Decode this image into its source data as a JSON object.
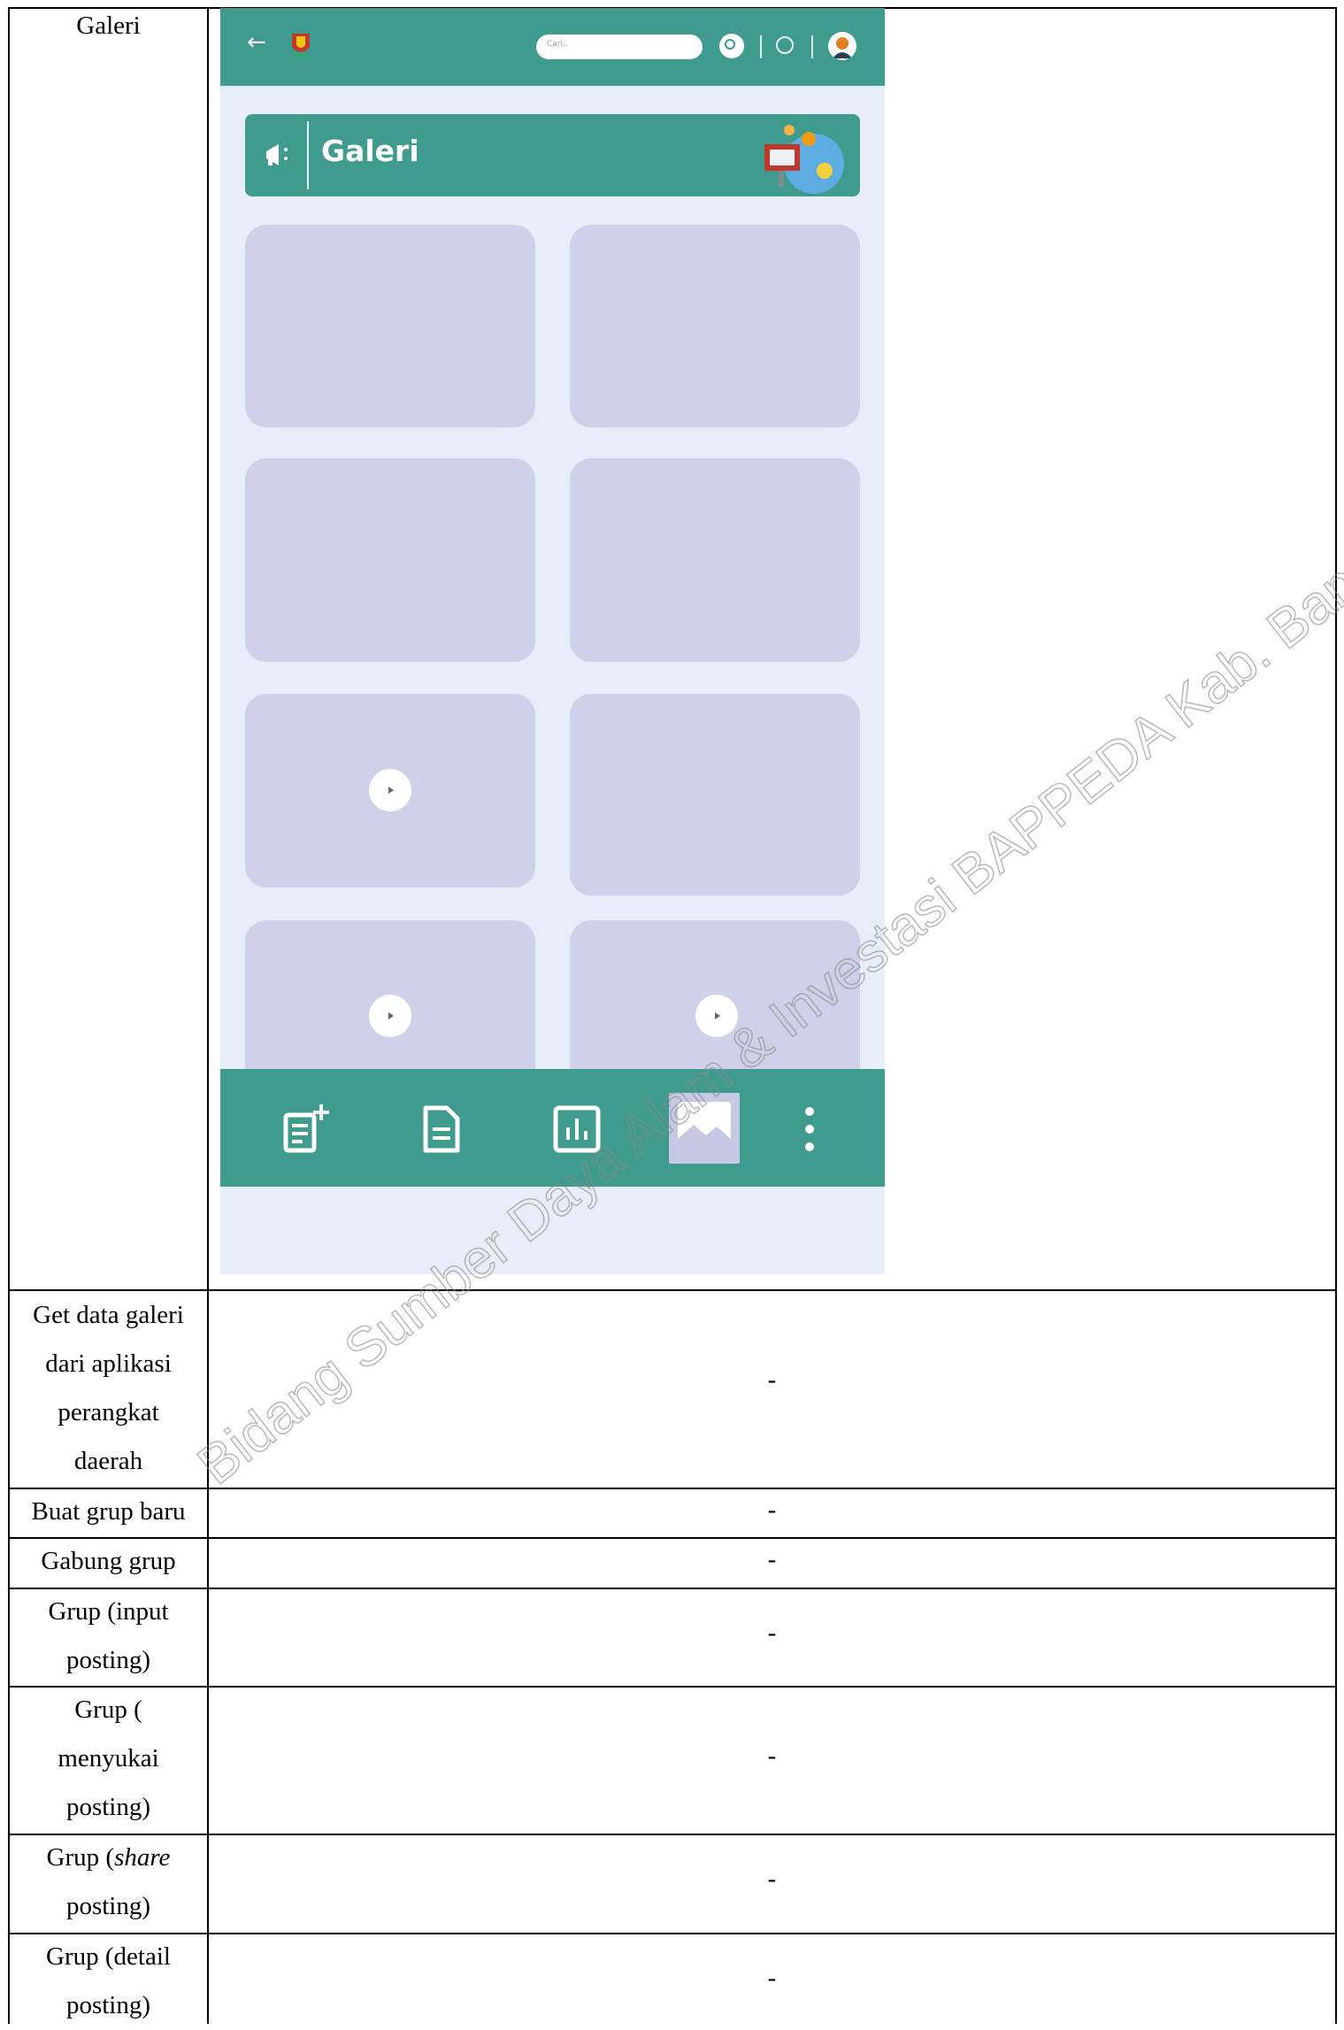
{
  "rows": [
    {
      "label_lines": [
        "Galeri"
      ],
      "value": ""
    },
    {
      "label_lines": [
        "Get data galeri",
        "dari aplikasi",
        "perangkat",
        "daerah"
      ],
      "value": "-"
    },
    {
      "label_lines": [
        "Buat grup baru"
      ],
      "value": "-"
    },
    {
      "label_lines": [
        "Gabung grup"
      ],
      "value": "-"
    },
    {
      "label_lines": [
        "Grup (input",
        "posting)"
      ],
      "value": "-"
    },
    {
      "label_lines": [
        "Grup (",
        "menyukai",
        "posting)"
      ],
      "value": "-"
    },
    {
      "label_lines": [
        "Grup (share",
        "posting)"
      ],
      "value": "-"
    },
    {
      "label_lines": [
        "Grup (detail",
        "posting)"
      ],
      "value": "-"
    }
  ],
  "phone": {
    "search_placeholder": "Cari..",
    "banner_title": "Galeri",
    "icons": {
      "back": "arrow-left-icon",
      "search": "search-icon",
      "chat": "chat-icon",
      "banner": "megaphone-icon",
      "nav": [
        "add-post-icon",
        "document-icon",
        "chart-icon",
        "gallery-icon",
        "more-vertical-icon"
      ]
    },
    "tiles": [
      {
        "video": false
      },
      {
        "video": false
      },
      {
        "video": false
      },
      {
        "video": false
      },
      {
        "video": true
      },
      {
        "video": false
      },
      {
        "video": true
      },
      {
        "video": true
      }
    ],
    "active_nav": "gallery"
  },
  "watermark": "Bidang Sumber Daya Alam & Investasi BAPPEDA Kab. Bandung",
  "colors": {
    "primary": "#3f9b8e",
    "background": "#e8eef9",
    "tile": "#ced1e8"
  }
}
